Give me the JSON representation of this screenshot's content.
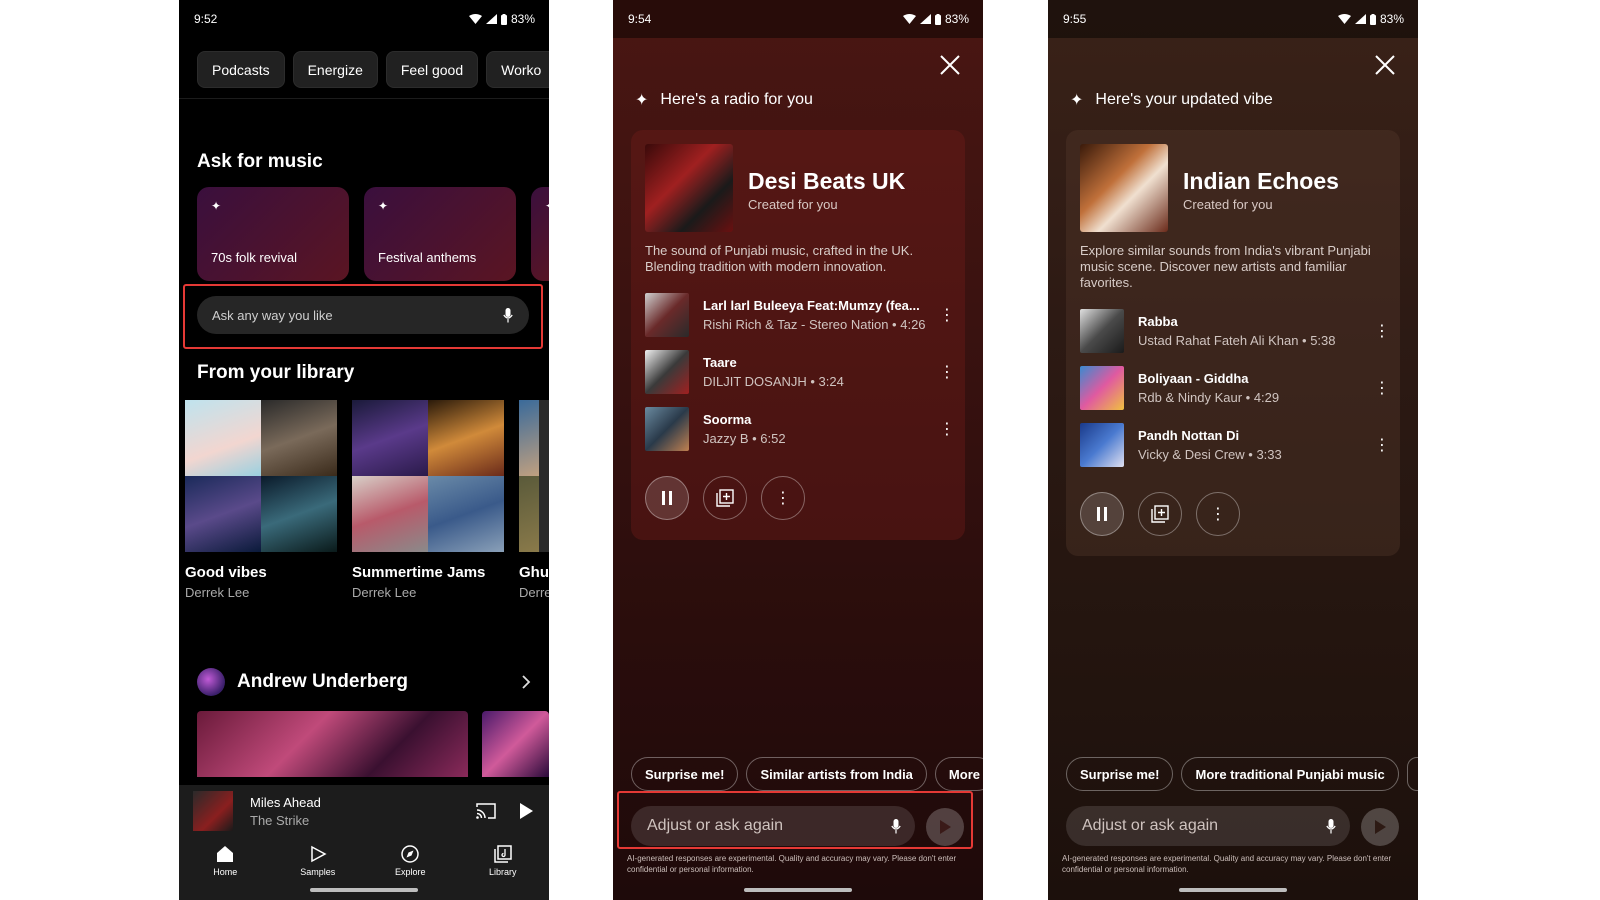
{
  "colors": {
    "highlight": "#e53935",
    "phone1_bg": "#000000",
    "phone2_bg": "#3a1210",
    "phone3_bg": "#2d1a14"
  },
  "phone1": {
    "status": {
      "time": "9:52",
      "battery": "83%"
    },
    "chips": [
      "Podcasts",
      "Energize",
      "Feel good",
      "Worko"
    ],
    "ask_heading": "Ask for music",
    "prompt_cards": [
      "70s folk revival",
      "Festival anthems"
    ],
    "ask_placeholder": "Ask any way you like",
    "library_heading": "From your library",
    "library": [
      {
        "title": "Good vibes",
        "owner": "Derrek Lee"
      },
      {
        "title": "Summertime Jams",
        "owner": "Derrek Lee"
      },
      {
        "title": "Ghu",
        "owner": "Derre"
      }
    ],
    "artist": "Andrew Underberg",
    "miniplayer": {
      "title": "Miles Ahead",
      "artist": "The Strike"
    },
    "nav": [
      "Home",
      "Samples",
      "Explore",
      "Library"
    ]
  },
  "phone2": {
    "status": {
      "time": "9:54",
      "battery": "83%"
    },
    "heading": "Here's a radio for you",
    "radio_title": "Desi Beats UK",
    "radio_sub": "Created for you",
    "description": "The sound of Punjabi music, crafted in the UK. Blending tradition with modern innovation.",
    "tracks": [
      {
        "title": "Larl larl Buleeya Feat:Mumzy (fea...",
        "sub": "Rishi Rich & Taz - Stereo Nation • 4:26"
      },
      {
        "title": "Taare",
        "sub": "DILJIT DOSANJH • 3:24"
      },
      {
        "title": "Soorma",
        "sub": "Jazzy B • 6:52"
      }
    ],
    "suggestions": [
      "Surprise me!",
      "Similar artists from India",
      "More"
    ],
    "input_placeholder": "Adjust or ask again",
    "disclaimer": "AI-generated responses are experimental. Quality and accuracy may vary. Please don't enter confidential or personal information."
  },
  "phone3": {
    "status": {
      "time": "9:55",
      "battery": "83%"
    },
    "heading": "Here's your updated vibe",
    "radio_title": "Indian Echoes",
    "radio_sub": "Created for you",
    "description": "Explore similar sounds from India's vibrant Punjabi music scene. Discover new artists and familiar favorites.",
    "tracks": [
      {
        "title": "Rabba",
        "sub": "Ustad Rahat Fateh Ali Khan • 5:38"
      },
      {
        "title": "Boliyaan - Giddha",
        "sub": "Rdb & Nindy Kaur • 4:29"
      },
      {
        "title": "Pandh Nottan Di",
        "sub": "Vicky & Desi Crew • 3:33"
      }
    ],
    "suggestions": [
      "Surprise me!",
      "More traditional Punjabi music"
    ],
    "input_placeholder": "Adjust or ask again",
    "disclaimer": "AI-generated responses are experimental. Quality and accuracy may vary. Please don't enter confidential or personal information."
  }
}
